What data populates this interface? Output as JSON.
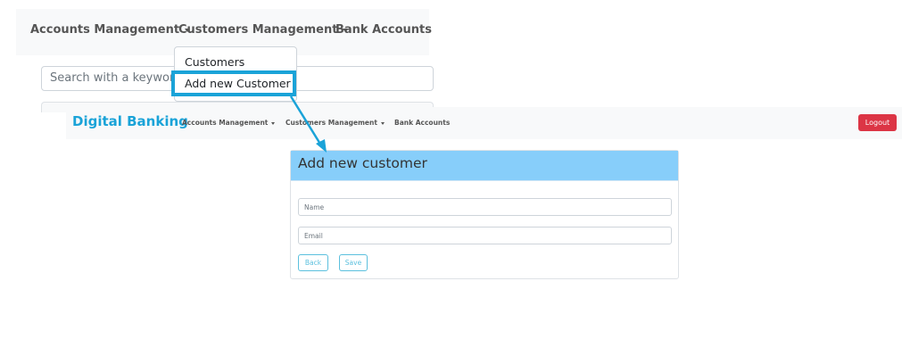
{
  "zoom": {
    "nav": {
      "accounts_management": "Accounts Management",
      "customers_management": "Customers Management",
      "bank_accounts": "Bank Accounts"
    },
    "search_placeholder": "Search with a keyword",
    "dropdown": {
      "customers": "Customers",
      "add_new_customer": "Add new Customer"
    },
    "highlight_color": "#1aa3d8"
  },
  "app": {
    "brand": "Digital Banking",
    "brand_color": "#1aa3d8",
    "nav": {
      "accounts_management": "Accounts Management",
      "customers_management": "Customers Management",
      "bank_accounts": "Bank Accounts"
    },
    "logout_label": "Logout",
    "logout_color": "#dc3545",
    "card": {
      "title": "Add new customer",
      "header_color": "#87cefa",
      "name_placeholder": "Name",
      "email_placeholder": "Email",
      "back_label": "Back",
      "save_label": "Save"
    }
  }
}
